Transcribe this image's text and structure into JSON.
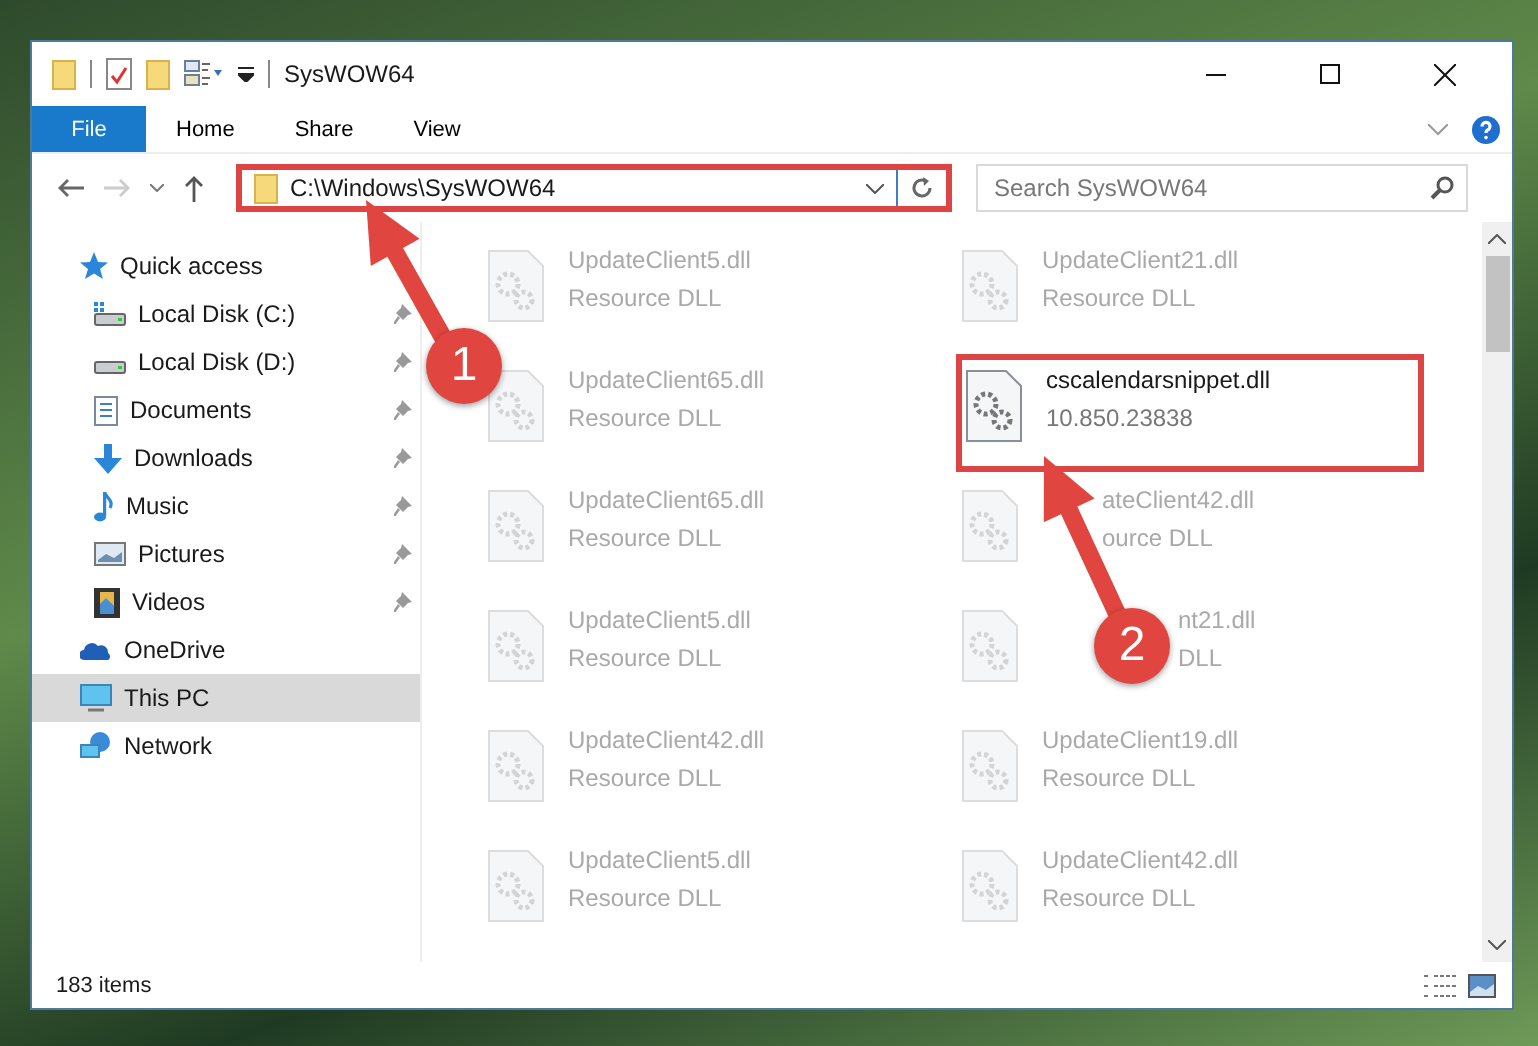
{
  "window": {
    "title": "SysWOW64"
  },
  "ribbon_tabs": [
    {
      "label": "File",
      "kind": "file"
    },
    {
      "label": "Home",
      "kind": "tab"
    },
    {
      "label": "Share",
      "kind": "tab"
    },
    {
      "label": "View",
      "kind": "tab"
    }
  ],
  "address_bar": {
    "path": "C:\\Windows\\SysWOW64",
    "outlined": true
  },
  "search": {
    "placeholder": "Search SysWOW64"
  },
  "sidebar": {
    "items": [
      {
        "label": "Quick access",
        "selected": false,
        "children": [
          {
            "label": "Local Disk (C:)",
            "pinned": true
          },
          {
            "label": "Local Disk (D:)",
            "pinned": true
          },
          {
            "label": "Documents",
            "pinned": true
          },
          {
            "label": "Downloads",
            "pinned": true
          },
          {
            "label": "Music",
            "pinned": true
          },
          {
            "label": "Pictures",
            "pinned": true
          },
          {
            "label": "Videos",
            "pinned": true
          }
        ]
      },
      {
        "label": "OneDrive",
        "selected": false
      },
      {
        "label": "This PC",
        "selected": true
      },
      {
        "label": "Network",
        "selected": false
      }
    ]
  },
  "files": [
    {
      "name": "UpdateClient5.dll",
      "detail": "Resource DLL",
      "emphasized": false
    },
    {
      "name": "UpdateClient21.dll",
      "detail": "Resource DLL",
      "emphasized": false
    },
    {
      "name": "UpdateClient65.dll",
      "detail": "Resource DLL",
      "emphasized": false
    },
    {
      "name": "cscalendarsnippet.dll",
      "detail": "10.850.23838",
      "emphasized": true
    },
    {
      "name": "UpdateClient65.dll",
      "detail": "Resource DLL",
      "emphasized": false
    },
    {
      "name": "ateClient42.dll",
      "detail": "ource DLL",
      "emphasized": false,
      "partly_covered": true
    },
    {
      "name": "UpdateClient5.dll",
      "detail": "Resource DLL",
      "emphasized": false
    },
    {
      "name": "nt21.dll",
      "detail": "DLL",
      "emphasized": false,
      "partly_covered": true
    },
    {
      "name": "UpdateClient42.dll",
      "detail": "Resource DLL",
      "emphasized": false
    },
    {
      "name": "UpdateClient19.dll",
      "detail": "Resource DLL",
      "emphasized": false
    },
    {
      "name": "UpdateClient5.dll",
      "detail": "Resource DLL",
      "emphasized": false
    },
    {
      "name": "UpdateClient42.dll",
      "detail": "Resource DLL",
      "emphasized": false
    }
  ],
  "status_bar": {
    "item_count": "183 items"
  },
  "annotations": [
    {
      "label": "1"
    },
    {
      "label": "2"
    }
  ]
}
